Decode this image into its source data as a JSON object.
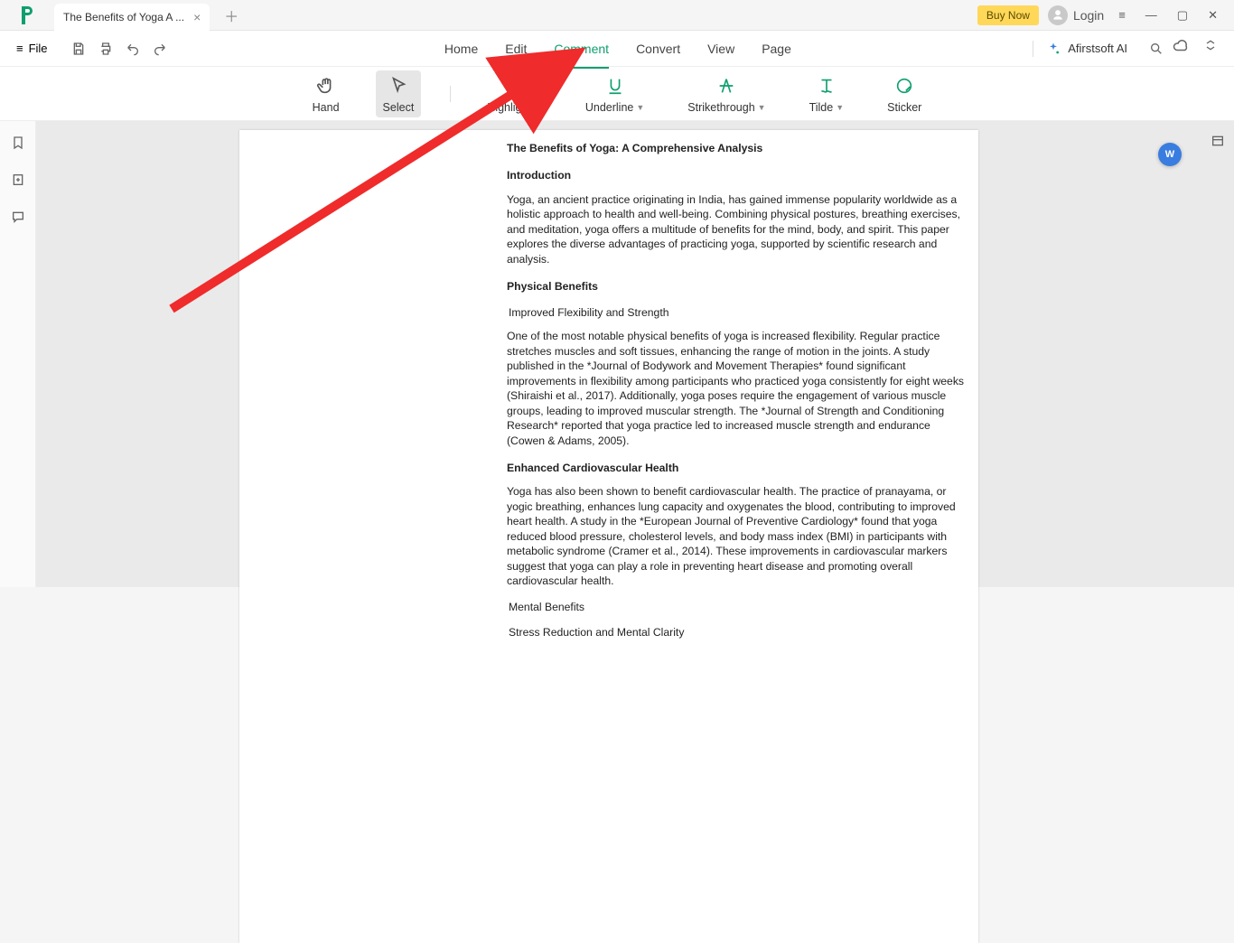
{
  "titlebar": {
    "tab_title": "The Benefits of Yoga A ...",
    "buynow": "Buy Now",
    "login": "Login"
  },
  "navbar": {
    "file_label": "File",
    "items": [
      "Home",
      "Edit",
      "Comment",
      "Convert",
      "View",
      "Page"
    ],
    "active_index": 2,
    "ai_label": "Afirstsoft AI"
  },
  "toolbar": {
    "tools": [
      {
        "label": "Hand",
        "name": "hand-tool"
      },
      {
        "label": "Select",
        "name": "select-tool"
      },
      {
        "label": "Highlight",
        "name": "highlight-tool",
        "dropdown": true
      },
      {
        "label": "Underline",
        "name": "underline-tool",
        "dropdown": true
      },
      {
        "label": "Strikethrough",
        "name": "strikethrough-tool",
        "dropdown": true
      },
      {
        "label": "Tilde",
        "name": "tilde-tool",
        "dropdown": true
      },
      {
        "label": "Sticker",
        "name": "sticker-tool"
      }
    ],
    "selected_index": 1
  },
  "document": {
    "title": "The Benefits of Yoga: A Comprehensive Analysis",
    "sections": {
      "intro_h": "Introduction",
      "intro_p": "Yoga, an ancient practice originating in India, has gained immense popularity worldwide as a holistic approach to health and well-being. Combining physical postures, breathing exercises, and meditation, yoga offers a multitude of benefits for the mind, body, and spirit. This paper explores the diverse advantages of practicing yoga, supported by scientific research and analysis.",
      "phys_h": "Physical Benefits",
      "flex_h": "Improved Flexibility and Strength",
      "flex_p": "One of the most notable physical benefits of yoga is increased flexibility. Regular practice stretches muscles and soft tissues, enhancing the range of motion in the joints. A study published in the *Journal of Bodywork and Movement Therapies* found significant improvements in flexibility among participants who practiced yoga consistently for eight weeks (Shiraishi et al., 2017). Additionally, yoga poses require the engagement of various muscle groups, leading to improved muscular strength. The *Journal of Strength and Conditioning Research* reported that yoga practice led to increased muscle strength and endurance (Cowen & Adams, 2005).",
      "card_h": "Enhanced Cardiovascular Health",
      "card_p": "Yoga has also been shown to benefit cardiovascular health. The practice of pranayama, or yogic breathing, enhances lung capacity and oxygenates the blood, contributing to improved heart health. A study in the *European Journal of Preventive Cardiology* found that yoga reduced blood pressure, cholesterol levels, and body mass index (BMI) in participants with metabolic syndrome (Cramer et al., 2014). These improvements in cardiovascular markers suggest that yoga can play a role in preventing heart disease and promoting overall cardiovascular health.",
      "mental_h": "Mental Benefits",
      "stress_h": "Stress Reduction and Mental Clarity"
    }
  },
  "float_badge": "W"
}
